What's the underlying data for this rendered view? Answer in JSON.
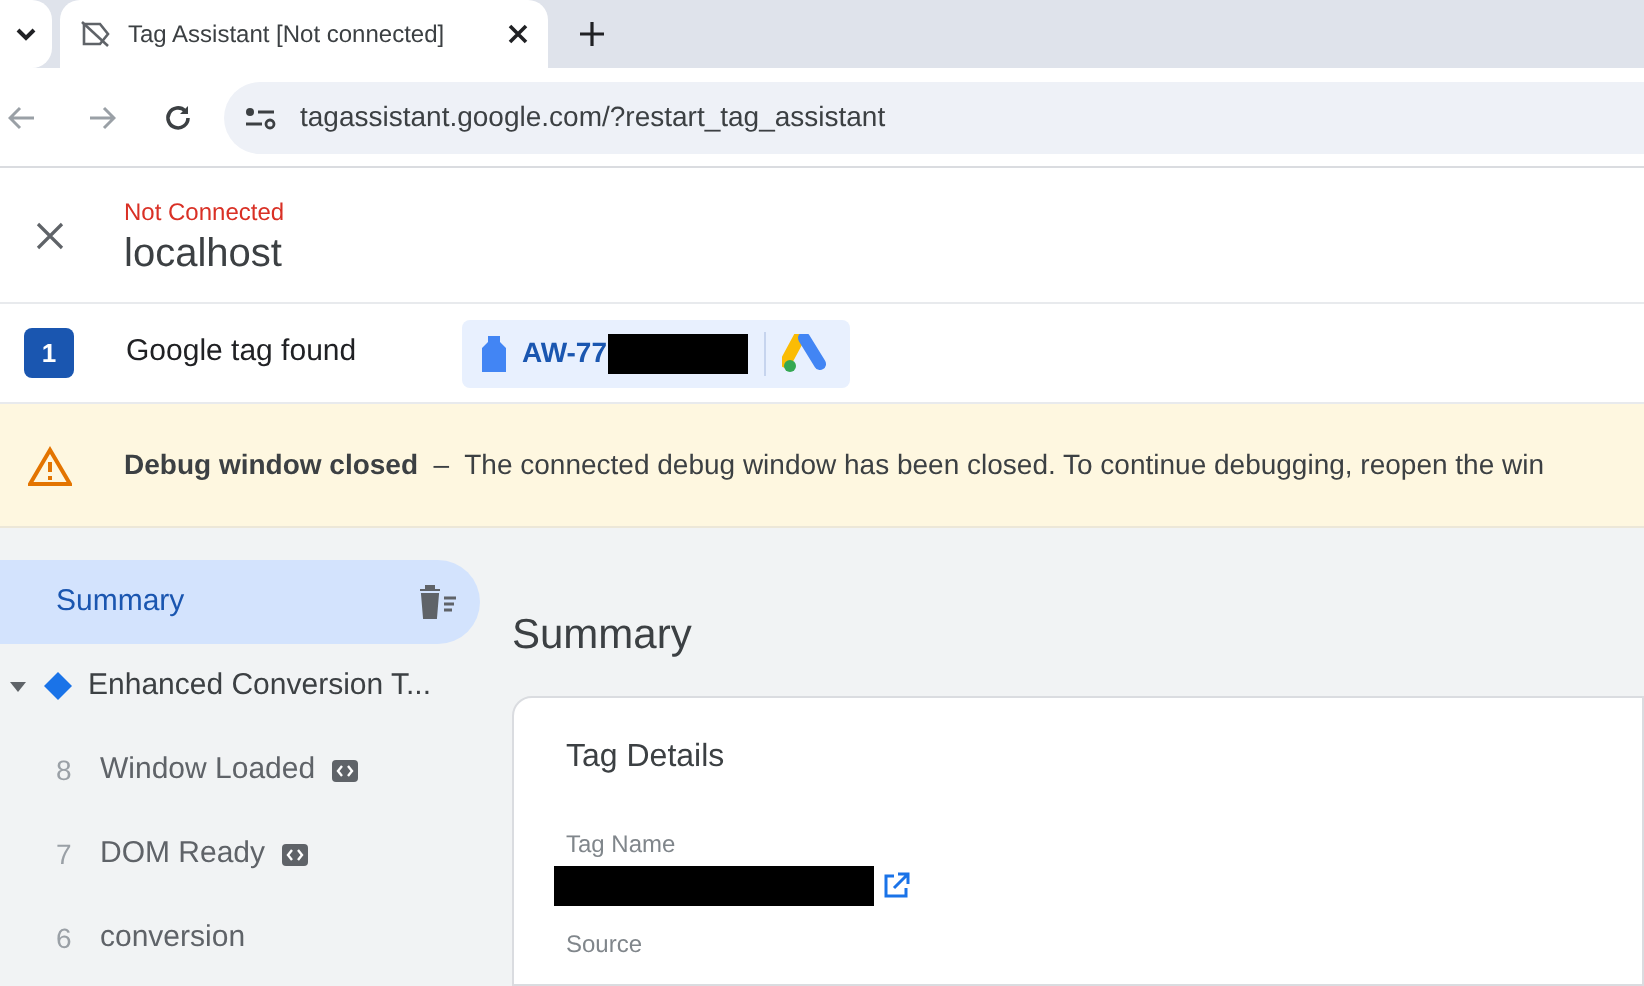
{
  "browser": {
    "tab_title": "Tag Assistant [Not connected]",
    "url": "tagassistant.google.com/?restart_tag_assistant"
  },
  "header": {
    "status": "Not Connected",
    "domain": "localhost"
  },
  "tag_row": {
    "count": "1",
    "label": "Google tag found",
    "tag_id": "AW-77"
  },
  "banner": {
    "message": "**Debug window closed**  –  The connected debug window has been closed. To continue debugging, reopen the win"
  },
  "sidebar": {
    "items": [
      {
        "kind": "summary",
        "label": "Summary",
        "selected": true
      },
      {
        "kind": "container",
        "label": "Enhanced Conversion T...",
        "selected": false,
        "expanded": true,
        "children": [
          {
            "kind": "event",
            "number": "8",
            "label": "Window Loaded",
            "selected": false,
            "code": true
          },
          {
            "kind": "event",
            "number": "7",
            "label": "DOM Ready",
            "selected": false,
            "code": true
          },
          {
            "kind": "event",
            "number": "6",
            "label": "conversion",
            "selected": false,
            "code": false
          }
        ]
      }
    ]
  },
  "main": {
    "title": "Summary",
    "card": {
      "title": "Tag Details",
      "fields": [
        {
          "label": "Tag Name",
          "redacted": true,
          "link": true
        },
        {
          "label": "Source"
        }
      ]
    }
  }
}
